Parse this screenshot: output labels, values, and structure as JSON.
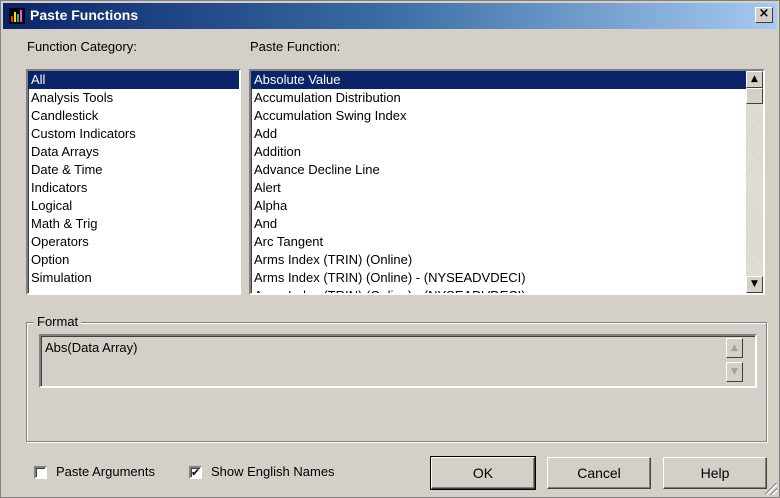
{
  "window": {
    "title": "Paste Functions",
    "close_label": "×"
  },
  "category": {
    "label": "Function Category:",
    "items": [
      "All",
      "Analysis Tools",
      "Candlestick",
      "Custom Indicators",
      "Data Arrays",
      "Date & Time",
      "Indicators",
      "Logical",
      "Math & Trig",
      "Operators",
      "Option",
      "Simulation"
    ],
    "selected": "All"
  },
  "functions": {
    "label": "Paste Function:",
    "items": [
      "Absolute Value",
      "Accumulation Distribution",
      "Accumulation Swing Index",
      "Add",
      "Addition",
      "Advance Decline Line",
      "Alert",
      "Alpha",
      "And",
      "Arc Tangent",
      "Arms Index (TRIN) (Online)",
      "Arms Index (TRIN) (Online) - (NYSEADVDECI)",
      "Arms Index (TRIN) (Online) - (NYSEADVDECI)"
    ],
    "selected": "Absolute Value"
  },
  "format": {
    "label": "Format",
    "value": "Abs(Data Array)"
  },
  "options": {
    "paste_arguments": {
      "label": "Paste Arguments",
      "checked": false
    },
    "show_english_names": {
      "label": "Show English Names",
      "checked": true
    }
  },
  "buttons": {
    "ok": "OK",
    "cancel": "Cancel",
    "help": "Help"
  },
  "icons": {
    "app": "chart-app-icon",
    "close": "close-icon",
    "scroll_up": "scroll-up-icon",
    "scroll_down": "scroll-down-icon"
  },
  "colors": {
    "title_start": "#0a246a",
    "title_end": "#a6caf0",
    "selection": "#0a246a",
    "face": "#d4d0c8"
  }
}
